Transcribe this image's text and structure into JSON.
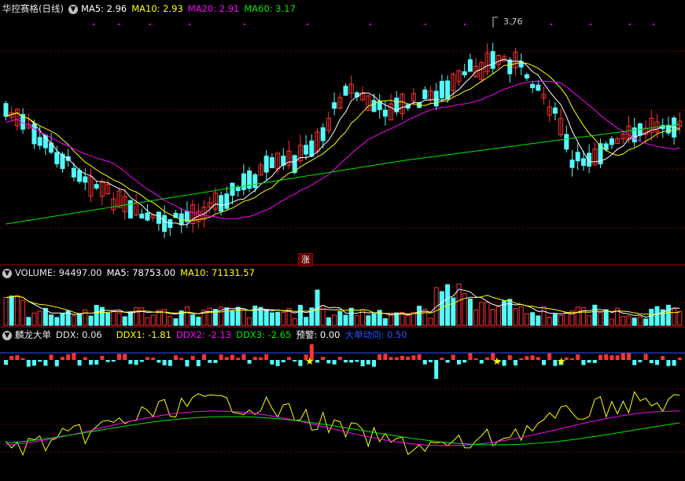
{
  "colors": {
    "up": "#ff3232",
    "down": "#54fcfc",
    "ma5": "#ffffff",
    "ma10": "#ffff00",
    "ma20": "#ff00ff",
    "ma60": "#00e600",
    "grid": "#b00000",
    "ddx": "#54fcfc",
    "ddx1": "#ffff00",
    "ddx2": "#ff00ff",
    "ddx3": "#00e600",
    "warn": "#ffffff",
    "dadan": "#3050ff"
  },
  "price_panel": {
    "title": "华控赛格(日线)",
    "ma5": "MA5: 2.96",
    "ma10": "MA10: 2.93",
    "ma20": "MA20: 2.91",
    "ma60": "MA60: 3.17",
    "high_label": "3.76"
  },
  "volume_panel": {
    "volume": "VOLUME: 94497.00",
    "ma5": "MA5: 78753.00",
    "ma10": "MA10: 71131.57"
  },
  "ddx_panel": {
    "name": "麟龙大单",
    "ddx": "DDX: 0.06",
    "ddx1": "DDX1: -1.81",
    "ddx2": "DDX2: -2.13",
    "ddx3": "DDX3: -2.65",
    "warn": "预警: 0.00",
    "dadan": "大单动向: 0.50"
  },
  "badge": {
    "zhang": "涨"
  },
  "icons": [
    "arrow-down-icon",
    "star-icon"
  ]
}
